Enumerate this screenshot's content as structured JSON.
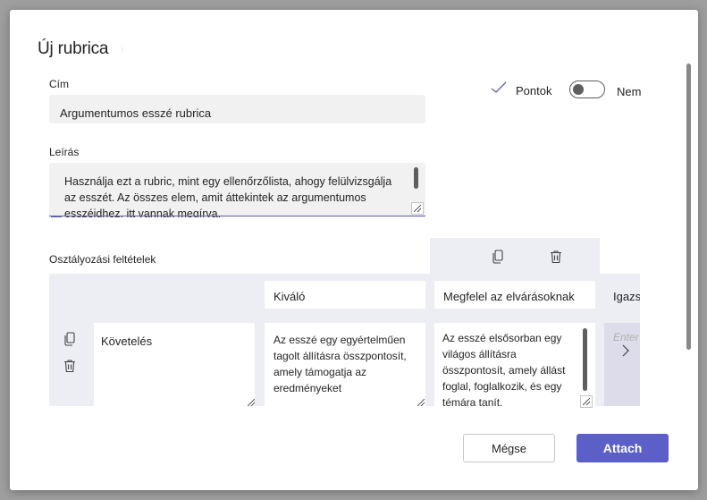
{
  "dialog": {
    "title": "Új rubrica"
  },
  "form": {
    "title_label": "Cím",
    "title_value": "Argumentumos esszé rubrica",
    "description_label": "Leírás",
    "description_value": "Használja ezt a rubric, mint egy ellenőrzőlista, ahogy felülvizsgálja az esszét. Az összes elem, amit áttekintek az argumentumos esszéidhez, itt vannak megírva."
  },
  "points": {
    "label": "Pontok",
    "state_label": "Nem",
    "enabled": false
  },
  "grading": {
    "section_label": "Osztályozási feltételek",
    "levels": [
      "Kiváló",
      "Megfelel az elvárásoknak",
      "Igazságos"
    ],
    "criteria": [
      {
        "name": "Követelés",
        "descriptions": [
          "Az esszé egy egyértelműen tagolt állításra összpontosít, amely támogatja az eredményeket",
          "Az esszé elsősorban egy világos állításra összpontosít, amely állást foglal, foglalkozik, és egy témára tanít."
        ],
        "placeholder": "Enter"
      }
    ]
  },
  "footer": {
    "cancel_label": "Mégse",
    "attach_label": "Attach"
  },
  "colors": {
    "accent": "#5b5fc7",
    "band": "#ededf4",
    "field_bg": "#f1f1f1"
  },
  "icons": [
    "check-icon",
    "copy-icon",
    "trash-icon",
    "chevron-right-icon"
  ]
}
